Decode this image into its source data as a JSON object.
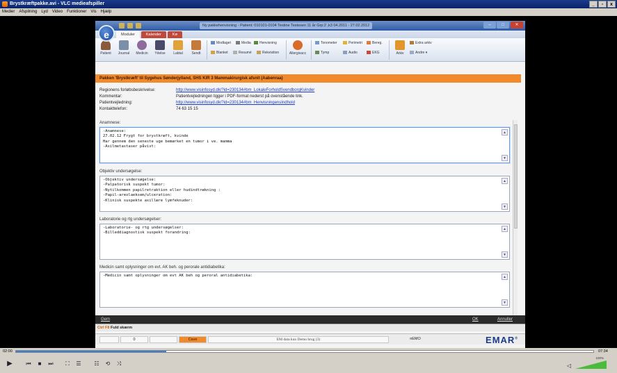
{
  "vlc": {
    "title": "Brystkræftpakke.avi - VLC medieafspiller",
    "menu": [
      "Medier",
      "Afspilning",
      "Lyd",
      "Video",
      "Funktioner",
      "Vis",
      "Hjælp"
    ],
    "time_elapsed": "02:00",
    "time_total": "07:34",
    "progress_percent": 26,
    "volume_percent": "100%",
    "volume_level": 1.0
  },
  "emar": {
    "window_caption": "Ny pakkehenvisning - Patient: 010101-0104 Testine Testesen 11 år Grp:2 ,k3 04.2011 - 27.02.2012",
    "ribbon_tabs": [
      "Moduler",
      "Kalender",
      "Kø"
    ],
    "ribbon_buttons": [
      "Patient",
      "Journal",
      "Medicin",
      "Ydelse",
      "Labtal",
      "Sendt"
    ],
    "ribbon_small_buttons": {
      "modtaget": "Modtaget",
      "media": "Media",
      "henvisning": "Henvisning",
      "blanket": "Blanket",
      "resume": "Resumé",
      "rekvisition": "Rekvisition",
      "allergivacc": "Allergivacc",
      "tonometer": "Tonometer",
      "perimetri": "Perimetri",
      "tymp": "Tymp",
      "audio": "Audio",
      "ekg": "EKG",
      "bereg": "Bereg.",
      "arkiv": "Arkiv",
      "extra_arkiv": "Extra arkiv",
      "andre": "Andre"
    },
    "banner": "Pakken 'Brystkræft' til Sygehus Sønderjylland, SHS KIR 3 Mammakirurgisk afsnit (Aabenraa)",
    "info": [
      {
        "label": "Regionens forløbsbeskrivelse:",
        "value": "http://www.visinfosyd.dk/?id=230134#bm_LokaleForholdSvendborgKvinder",
        "link": true
      },
      {
        "label": "Kommentar:",
        "value": "Patientvejledningen ligger i PDF-format nederst på ovenstående link.",
        "link": false
      },
      {
        "label": "Patientvejledning:",
        "value": "http://www.visinfosyd.dk/?id=230134#bm_HenvisningensIndhold",
        "link": true
      },
      {
        "label": "Kontakttelefon:",
        "value": "74 63 15 15",
        "link": false
      }
    ],
    "sections": [
      {
        "label": "Anamnese:",
        "text": "-Anamnese:\n27.02.12 Frygt for brystkræft, kvinde\nHar gennem den seneste uge bemærket en tumor i ve. mamma\n-Axilmetastaser påvist: "
      },
      {
        "label": "Objektiv undersøgelse:",
        "text": "-Objektiv undersøgelse:\n-Palpatorisk suspekt tumor:\n-Nytilkommen papilretraktion eller hudindtrækning :\n-Papil-areolaeksem/ulceration:\n-Klinisk suspekte axillære lymfeknuder:"
      },
      {
        "label": "Laboratorie og rtg undersøgelser:",
        "text": "-Laboratorie- og rtg undersøgelser:\n-Billeddiagnostisk suspekt forandring:"
      },
      {
        "label": "Medicin samt oplysninger om evt. AK beh. og perorale antidiabetika:",
        "text": "-Medicin samt oplysninger om evt AK beh og peroral antidiabetika:"
      }
    ],
    "bottom": {
      "gem": "Gem",
      "ok": "OK",
      "annuller": "Annuller"
    },
    "fullscreen": {
      "key": "Ctrl F8",
      "label": "Fuld skærm"
    },
    "status": {
      "count": "0",
      "mode": "Cave",
      "message": "EM data kun Demo brug (3)",
      "tag": "nEMO"
    },
    "brand": "EMAR"
  }
}
